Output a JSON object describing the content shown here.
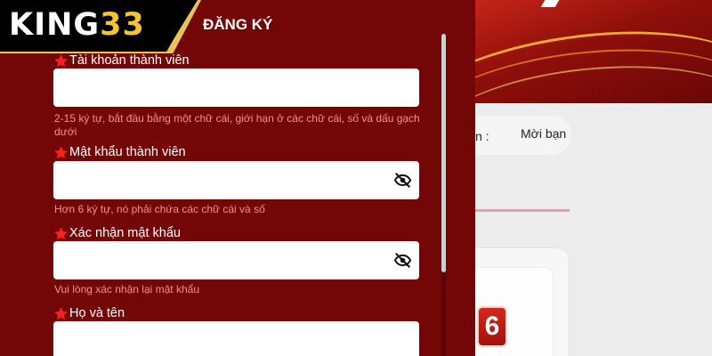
{
  "background": {
    "notice_label": "g lớn :",
    "notice_text": "Mời bạn",
    "tile_number": "6"
  },
  "header": {
    "logo_main": "KING",
    "logo_num": "33",
    "title": "ĐĂNG KÝ"
  },
  "form": {
    "username": {
      "label": "Tài khoản thành viên",
      "value": "",
      "hint": "2-15 ký tự, bắt đầu bằng một chữ cái, giới hạn ở các chữ cái, số và dấu gạch dưới"
    },
    "password": {
      "label": "Mật khẩu thành viên",
      "value": "",
      "hint": "Hơn 6 ký tự, nó phải chứa các chữ cái và số",
      "icon": "eye-slash-icon"
    },
    "confirm_password": {
      "label": "Xác nhận mật khẩu",
      "value": "",
      "hint": "Vui lòng xác nhận lại mật khẩu",
      "icon": "eye-slash-icon"
    },
    "full_name": {
      "label": "Họ và tên",
      "value": ""
    }
  },
  "colors": {
    "panel_bg": "#730708",
    "required_star": "#ff1f1f",
    "hint_text": "#ff8b8b",
    "logo_gold": "#f4c531"
  }
}
